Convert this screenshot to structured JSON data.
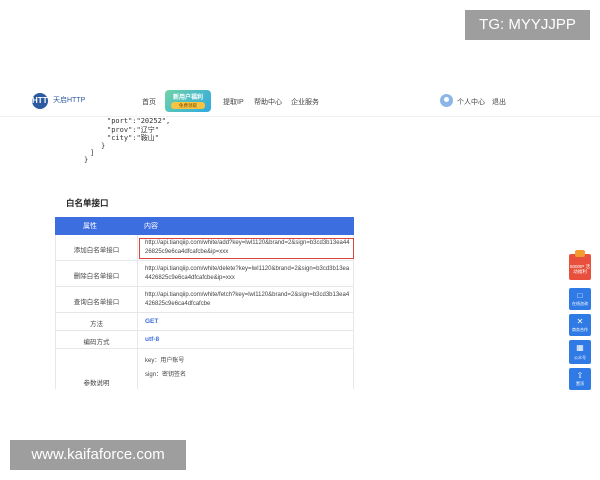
{
  "watermark_top": "TG: MYYJJPP",
  "watermark_bottom": "www.kaifaforce.com",
  "nav": {
    "logo_glyph": "HTTP",
    "logo_text": "天启HTTP",
    "items": [
      "首页",
      "提取IP",
      "帮助中心",
      "企业服务"
    ],
    "promo_title": "新用户福利",
    "promo_sub": "免费领取",
    "user": "个人中心",
    "logout": "退出"
  },
  "code_lines": [
    "\"port\":\"20252\",",
    "\"prov\":\"辽宁\"",
    "\"city\":\"鞍山\"",
    "}",
    "]",
    "}"
  ],
  "section_title": "白名单接口",
  "table": {
    "col_attr": "属性",
    "col_content": "内容",
    "rows": [
      {
        "key": "添加白名单接口",
        "value": "http://api.tianqiip.com/white/add?key=lwl1120&brand=2&sign=b3cd3b13ea4426825c9e6ca4dfcafcbe&ip=xxx"
      },
      {
        "key": "删除白名单接口",
        "value": "http://api.tianqiip.com/white/delete?key=lwl1120&brand=2&sign=b3cd3b13ea4426825c9e6ca4dfcafcbe&ip=xxx"
      },
      {
        "key": "查询白名单接口",
        "value": "http://api.tianqiip.com/white/fetch?key=lwl1120&brand=2&sign=b3cd3b13ea4426825c9e6ca4dfcafcbe"
      },
      {
        "key": "方法",
        "value": "GET"
      },
      {
        "key": "编码方式",
        "value": "utf-8"
      },
      {
        "key": "参数说明",
        "params": [
          "key：用户账号",
          "sign：密钥签名"
        ]
      }
    ]
  },
  "sidebar": {
    "gift": "5000IP 活动福利",
    "items": [
      {
        "icon": "chat-icon",
        "label": "在线咨询"
      },
      {
        "icon": "handshake-icon",
        "label": "商务合作"
      },
      {
        "icon": "public-account-icon",
        "label": "公众号"
      },
      {
        "icon": "to-top-icon",
        "label": "置顶"
      }
    ]
  },
  "colors": {
    "primary": "#3d6ee0",
    "highlight": "#d9453c",
    "sidebar": "#2f7ae5"
  }
}
